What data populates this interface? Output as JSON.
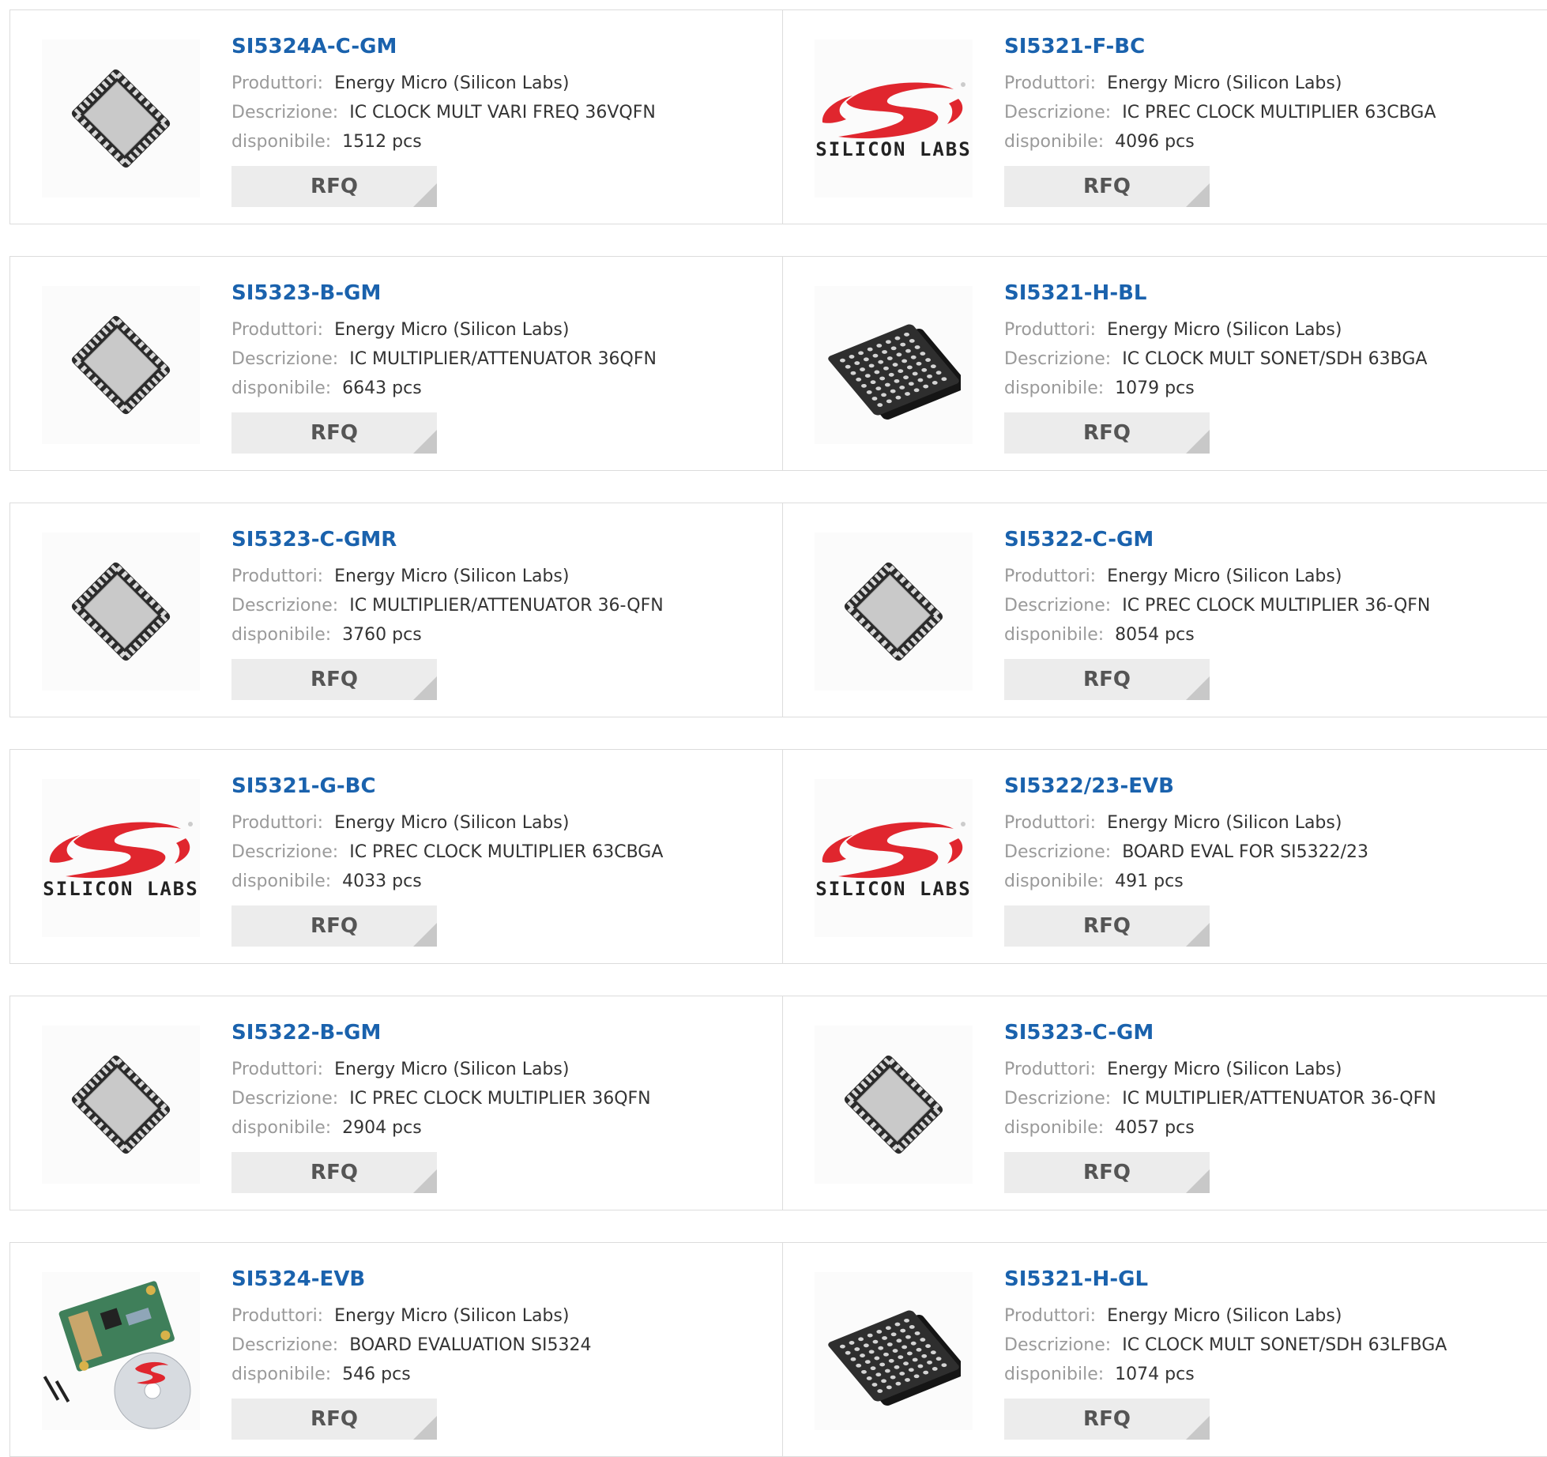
{
  "labels": {
    "manufacturer": "Produttori:",
    "description": "Descrizione:",
    "available": "disponibile:",
    "rfq": "RFQ"
  },
  "products": [
    {
      "part": "SI5324A-C-GM",
      "manufacturer": "Energy Micro (Silicon Labs)",
      "description": "IC CLOCK MULT VARI FREQ 36VQFN",
      "available": "1512 pcs",
      "image": "qfn-chip-icon"
    },
    {
      "part": "SI5321-F-BC",
      "manufacturer": "Energy Micro (Silicon Labs)",
      "description": "IC PREC CLOCK MULTIPLIER 63CBGA",
      "available": "4096 pcs",
      "image": "silicon-labs-logo",
      "logo_text": "SILICON LABS"
    },
    {
      "part": "SI5323-B-GM",
      "manufacturer": "Energy Micro (Silicon Labs)",
      "description": "IC MULTIPLIER/ATTENUATOR 36QFN",
      "available": "6643 pcs",
      "image": "qfn-chip-icon"
    },
    {
      "part": "SI5321-H-BL",
      "manufacturer": "Energy Micro (Silicon Labs)",
      "description": "IC CLOCK MULT SONET/SDH 63BGA",
      "available": "1079 pcs",
      "image": "bga-chip-icon"
    },
    {
      "part": "SI5323-C-GMR",
      "manufacturer": "Energy Micro (Silicon Labs)",
      "description": "IC MULTIPLIER/ATTENUATOR 36-QFN",
      "available": "3760 pcs",
      "image": "qfn-chip-icon"
    },
    {
      "part": "SI5322-C-GM",
      "manufacturer": "Energy Micro (Silicon Labs)",
      "description": "IC PREC CLOCK MULTIPLIER 36-QFN",
      "available": "8054 pcs",
      "image": "qfn-chip-icon"
    },
    {
      "part": "SI5321-G-BC",
      "manufacturer": "Energy Micro (Silicon Labs)",
      "description": "IC PREC CLOCK MULTIPLIER 63CBGA",
      "available": "4033 pcs",
      "image": "silicon-labs-logo",
      "logo_text": "SILICON LABS"
    },
    {
      "part": "SI5322/23-EVB",
      "manufacturer": "Energy Micro (Silicon Labs)",
      "description": "BOARD EVAL FOR SI5322/23",
      "available": "491 pcs",
      "image": "silicon-labs-logo",
      "logo_text": "SILICON LABS"
    },
    {
      "part": "SI5322-B-GM",
      "manufacturer": "Energy Micro (Silicon Labs)",
      "description": "IC PREC CLOCK MULTIPLIER 36QFN",
      "available": "2904 pcs",
      "image": "qfn-chip-icon"
    },
    {
      "part": "SI5323-C-GM",
      "manufacturer": "Energy Micro (Silicon Labs)",
      "description": "IC MULTIPLIER/ATTENUATOR 36-QFN",
      "available": "4057 pcs",
      "image": "qfn-chip-icon"
    },
    {
      "part": "SI5324-EVB",
      "manufacturer": "Energy Micro (Silicon Labs)",
      "description": "BOARD EVALUATION SI5324",
      "available": "546 pcs",
      "image": "eval-board-photo"
    },
    {
      "part": "SI5321-H-GL",
      "manufacturer": "Energy Micro (Silicon Labs)",
      "description": "IC CLOCK MULT SONET/SDH 63LFBGA",
      "available": "1074 pcs",
      "image": "bga-chip-icon"
    }
  ],
  "colors": {
    "link": "#1a62ad",
    "label": "#9a9a9a",
    "border": "#dcdcdc",
    "button": "#ececec",
    "logo_red": "#e0262e"
  }
}
